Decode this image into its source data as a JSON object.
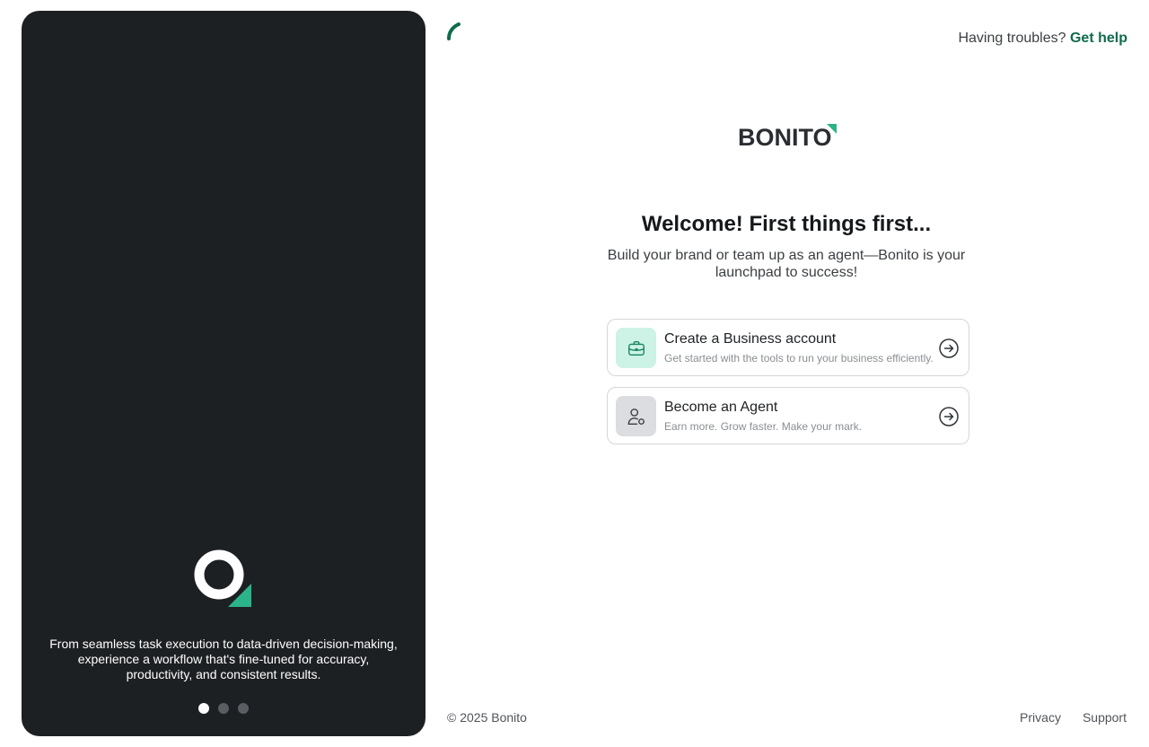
{
  "left_panel": {
    "tagline": "From seamless task execution to data-driven decision-making, experience a workflow that's fine-tuned for accuracy, productivity, and consistent results.",
    "slides": 3,
    "active_slide": 1
  },
  "header": {
    "help_prefix": "Having troubles?",
    "help_link": "Get help"
  },
  "brand": {
    "wordmark": "BONITO",
    "accent_color": "#2bb389",
    "text_color": "#2a2e33"
  },
  "main": {
    "title": "Welcome! First things first...",
    "subtitle": "Build your brand or team up as an agent—Bonito is your launchpad to success!",
    "options": [
      {
        "title": "Create a Business account",
        "description": "Get started with the tools to run your business efficiently.",
        "icon": "briefcase-icon"
      },
      {
        "title": "Become an Agent",
        "description": "Earn more. Grow faster. Make your mark.",
        "icon": "user-badge-icon"
      }
    ]
  },
  "footer": {
    "copyright": "© 2025 Bonito",
    "links": [
      "Privacy",
      "Support"
    ]
  },
  "colors": {
    "primary": "#0f6b4d",
    "panel_bg": "#1d2023",
    "business_icon_bg": "#cdf2e6",
    "agent_icon_bg": "#dcdde0"
  }
}
